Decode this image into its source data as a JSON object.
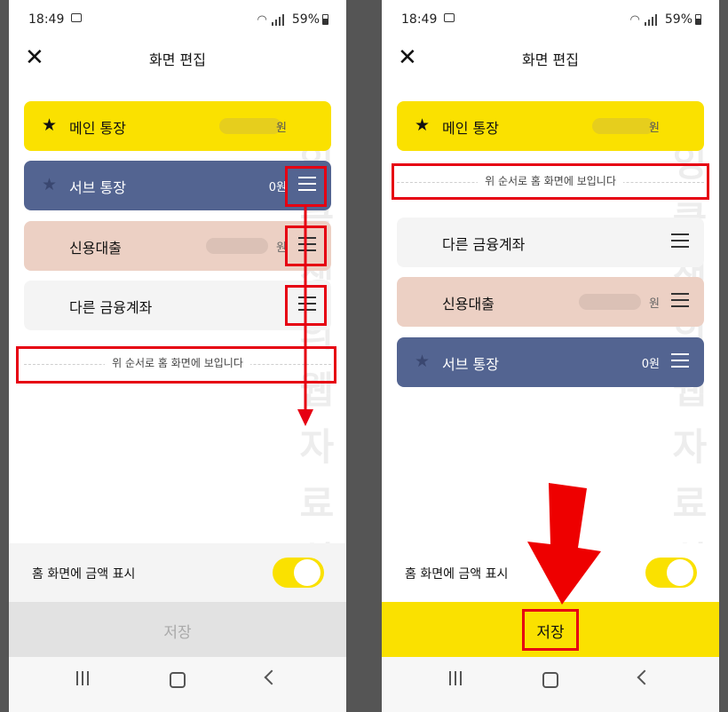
{
  "status_bar": {
    "time": "18:49",
    "battery": "59%"
  },
  "header": {
    "title": "화면 편집"
  },
  "divider_text": "위 순서로 홈 화면에 보입니다",
  "amount_toggle": {
    "label": "홈 화면에 금액 표시",
    "on": true
  },
  "save_label": "저장",
  "watermark_chars": [
    "잉",
    "클",
    "생",
    "의",
    "웹",
    "자",
    "료",
    "실"
  ],
  "left_screen": {
    "cards": [
      {
        "label": "메인 통장",
        "amount": "원",
        "amount_blurred": true,
        "starred": true,
        "color": "#fae100"
      },
      {
        "label": "서브 통장",
        "amount": "0원",
        "amount_blurred": false,
        "starred": false,
        "color": "#536491"
      },
      {
        "label": "신용대출",
        "amount": "원",
        "amount_blurred": true,
        "color": "#ecd0c4"
      },
      {
        "label": "다른 금융계좌",
        "amount": "",
        "color": "#f4f4f4"
      }
    ],
    "save_state": "disabled"
  },
  "right_screen": {
    "cards_above_divider": [
      {
        "label": "메인 통장",
        "amount": "원",
        "amount_blurred": true,
        "starred": true,
        "color": "#fae100"
      }
    ],
    "cards_below_divider": [
      {
        "label": "다른 금융계좌",
        "amount": "",
        "color": "#f4f4f4"
      },
      {
        "label": "신용대출",
        "amount": "원",
        "amount_blurred": true,
        "color": "#ecd0c4"
      },
      {
        "label": "서브 통장",
        "amount": "0원",
        "starred": false,
        "color": "#536491"
      }
    ],
    "save_state": "enabled"
  },
  "annotation_color": "#e60012"
}
